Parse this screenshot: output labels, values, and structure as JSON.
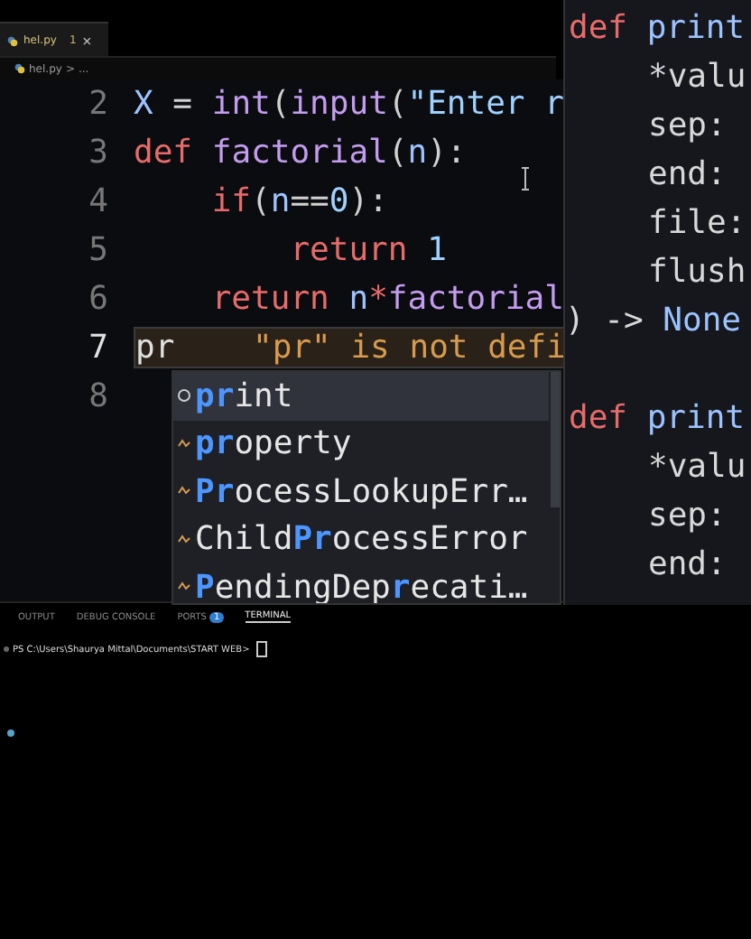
{
  "tab": {
    "label": "hel.py",
    "problems": "1",
    "close": "×",
    "selected": true
  },
  "breadcrumb": {
    "file": "hel.py",
    "separator": ">",
    "rest": "..."
  },
  "code": [
    {
      "number": "2",
      "current": false,
      "tokens": [
        {
          "kind": "var",
          "text": "X"
        },
        {
          "kind": "op",
          "text": " = "
        },
        {
          "kind": "func",
          "text": "int"
        },
        {
          "kind": "op",
          "text": "("
        },
        {
          "kind": "func",
          "text": "input"
        },
        {
          "kind": "op",
          "text": "("
        },
        {
          "kind": "string",
          "text": "\"Enter r"
        }
      ]
    },
    {
      "number": "3",
      "current": false,
      "tokens": [
        {
          "kind": "keyword",
          "text": "def "
        },
        {
          "kind": "func",
          "text": "factorial"
        },
        {
          "kind": "op",
          "text": "("
        },
        {
          "kind": "var",
          "text": "n"
        },
        {
          "kind": "op",
          "text": "):"
        }
      ]
    },
    {
      "number": "4",
      "current": false,
      "tokens": [
        {
          "kind": "keyword",
          "text": "    if"
        },
        {
          "kind": "op",
          "text": "("
        },
        {
          "kind": "var",
          "text": "n"
        },
        {
          "kind": "op",
          "text": "=="
        },
        {
          "kind": "number",
          "text": "0"
        },
        {
          "kind": "op",
          "text": "):"
        }
      ]
    },
    {
      "number": "5",
      "current": false,
      "tokens": [
        {
          "kind": "keyword",
          "text": "        return "
        },
        {
          "kind": "number",
          "text": "1"
        }
      ]
    },
    {
      "number": "6",
      "current": false,
      "tokens": [
        {
          "kind": "keyword",
          "text": "    return "
        },
        {
          "kind": "var",
          "text": "n"
        },
        {
          "kind": "keyword",
          "text": "*"
        },
        {
          "kind": "func",
          "text": "factorial"
        }
      ]
    },
    {
      "number": "7",
      "current": true,
      "tokens": [
        {
          "kind": "plain",
          "text": "pr"
        },
        {
          "kind": "error",
          "text": "    \"pr\" is not defi"
        }
      ]
    },
    {
      "number": "8",
      "current": false
    }
  ],
  "suggestions": [
    {
      "selected": true,
      "parts": [
        {
          "text": "pr",
          "match": true
        },
        {
          "text": "int",
          "match": false
        }
      ]
    },
    {
      "selected": false,
      "parts": [
        {
          "text": "pr",
          "match": true
        },
        {
          "text": "operty",
          "match": false
        }
      ]
    },
    {
      "selected": false,
      "parts": [
        {
          "text": "Pr",
          "match": true
        },
        {
          "text": "ocessLookupErr…",
          "match": false
        }
      ]
    },
    {
      "selected": false,
      "parts": [
        {
          "text": "Child",
          "match": false
        },
        {
          "text": "Pr",
          "match": true
        },
        {
          "text": "ocessError",
          "match": false
        }
      ]
    },
    {
      "selected": false,
      "parts": [
        {
          "text": "P",
          "match": true
        },
        {
          "text": "endingDep",
          "match": false
        },
        {
          "text": "r",
          "match": true
        },
        {
          "text": "ecati…",
          "match": false
        }
      ]
    }
  ],
  "hover": [
    {
      "kind": "def",
      "text": "def",
      "name": "print"
    },
    {
      "kind": "param",
      "text": "*valu"
    },
    {
      "kind": "param",
      "text": "sep:"
    },
    {
      "kind": "param",
      "text": "end:"
    },
    {
      "kind": "param",
      "text": "file:"
    },
    {
      "kind": "param",
      "text": "flush"
    },
    {
      "kind": "ret",
      "text": ") ->",
      "name": "None"
    },
    {
      "kind": "blank"
    },
    {
      "kind": "def",
      "text": "def",
      "name": "print"
    },
    {
      "kind": "param",
      "text": "*valu"
    },
    {
      "kind": "param",
      "text": "sep:"
    },
    {
      "kind": "param",
      "text": "end:"
    }
  ],
  "panel_tabs": [
    {
      "label": "OUTPUT",
      "selected": false
    },
    {
      "label": "DEBUG CONSOLE",
      "selected": false
    },
    {
      "label": "PORTS",
      "badge": "1",
      "selected": false
    },
    {
      "label": "TERMINAL",
      "selected": true
    }
  ],
  "terminal": {
    "prompt": "PS C:\\Users\\Shaurya Mittal\\Documents\\START WEB>"
  }
}
